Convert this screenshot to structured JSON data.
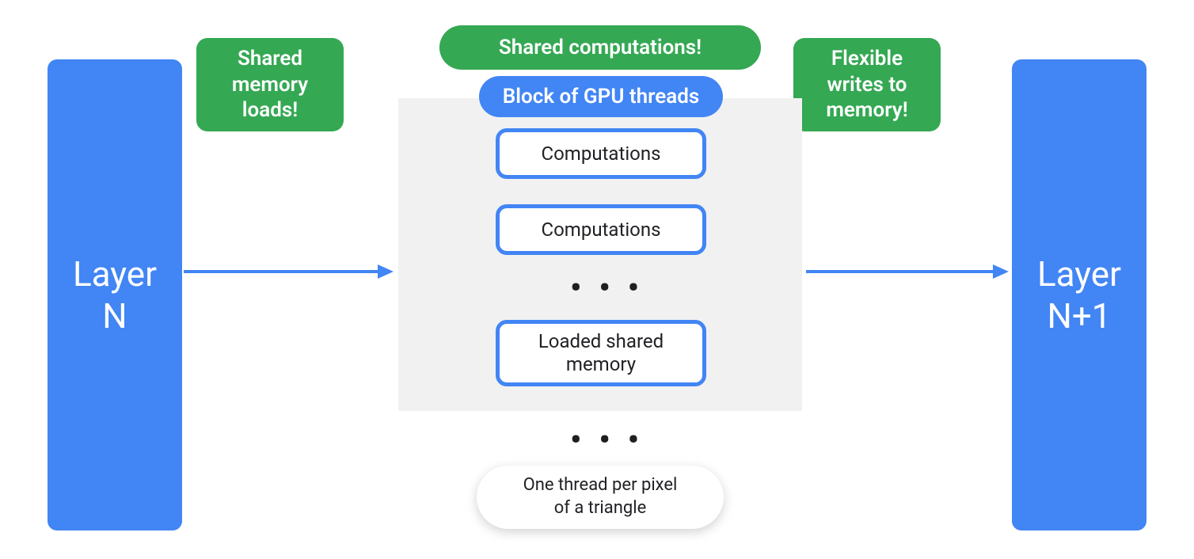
{
  "colors": {
    "blue": "#4285f4",
    "green": "#34a853",
    "gray_bg": "#f1f1f1",
    "text_dark": "#202124",
    "white": "#ffffff"
  },
  "layers": {
    "left": "Layer\nN",
    "right": "Layer\nN+1"
  },
  "callouts": {
    "shared_loads": "Shared\nmemory\nloads!",
    "shared_computations": "Shared computations!",
    "flexible_writes": "Flexible\nwrites to\nmemory!"
  },
  "center": {
    "header": "Block of GPU threads",
    "items": {
      "comp1": "Computations",
      "comp2": "Computations",
      "shared_mem": "Loaded shared\nmemory"
    },
    "ellipsis": "• • •",
    "footer": "One thread per pixel\nof a triangle"
  }
}
